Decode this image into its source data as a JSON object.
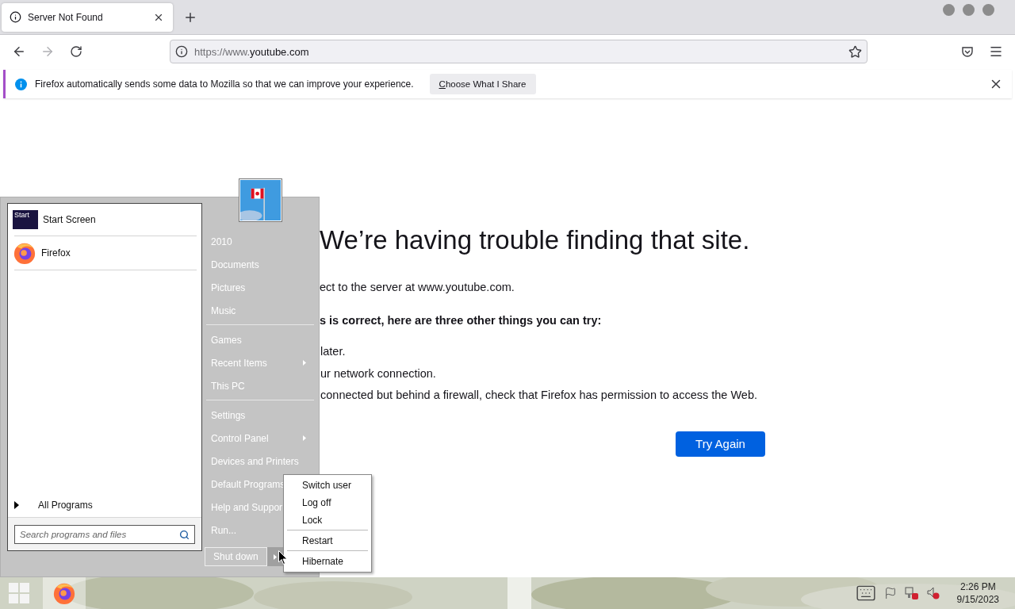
{
  "browser": {
    "tabs": [
      {
        "title": "Server Not Found",
        "selected": true
      }
    ],
    "nav": {
      "back_disabled": false,
      "forward_disabled": true
    },
    "url": {
      "prefix": "https://www.",
      "host": "youtube.com"
    },
    "notification": {
      "message": "Firefox automatically sends some data to Mozilla so that we can improve your experience.",
      "button": "Choose What I Share"
    }
  },
  "error_page": {
    "title": "We’re having trouble finding that site.",
    "message": "ect to the server at www.youtube.com.",
    "heading": "s is correct, here are three other things you can try:",
    "tips": [
      "later.",
      "ur network connection.",
      "connected but behind a firewall, check that Firefox has permission to access the Web."
    ],
    "button": "Try Again"
  },
  "start_menu": {
    "pinned": [
      {
        "kind": "tile",
        "label": "Start Screen",
        "tile_text": "Start"
      },
      {
        "kind": "firefox",
        "label": "Firefox"
      }
    ],
    "all_programs": "All Programs",
    "search_placeholder": "Search programs and files",
    "places": [
      [
        {
          "label": "2010",
          "submenu": false
        },
        {
          "label": "Documents",
          "submenu": false
        },
        {
          "label": "Pictures",
          "submenu": false
        },
        {
          "label": "Music",
          "submenu": false
        }
      ],
      [
        {
          "label": "Games",
          "submenu": false
        },
        {
          "label": "Recent Items",
          "submenu": true
        },
        {
          "label": "This PC",
          "submenu": false
        }
      ],
      [
        {
          "label": "Settings",
          "submenu": false
        },
        {
          "label": "Control Panel",
          "submenu": true
        },
        {
          "label": "Devices and Printers",
          "submenu": false
        },
        {
          "label": "Default Programs"
        },
        {
          "label": "Help and Suppor"
        },
        {
          "label": "Run..."
        }
      ]
    ],
    "shutdown": "Shut down",
    "shutdown_options": [
      [
        "Switch user",
        "Log off",
        "Lock"
      ],
      [
        "Restart"
      ],
      [
        "Hibernate"
      ]
    ]
  },
  "taskbar": {
    "time": "2:26 PM",
    "date": "9/15/2023"
  }
}
